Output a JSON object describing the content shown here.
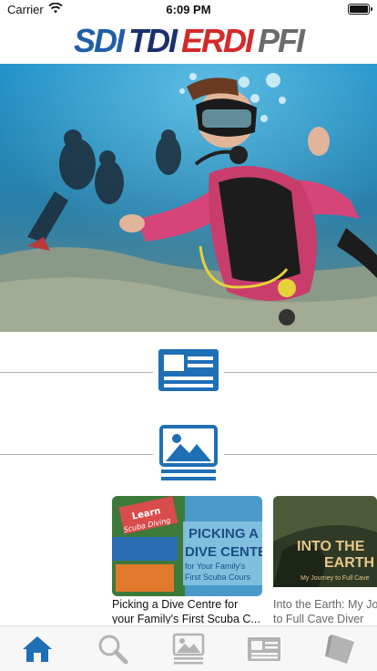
{
  "status_bar": {
    "carrier": "Carrier",
    "time": "6:09 PM",
    "battery_level": 1.0
  },
  "header": {
    "brands": [
      "SDI",
      "TDI",
      "ERDI",
      "PFI"
    ],
    "brand_colors": [
      "#1f5fa8",
      "#1c2f6e",
      "#d42a2a",
      "#6b6b6b"
    ]
  },
  "hero": {
    "icon": "scuba-divers-photo"
  },
  "sections": [
    {
      "icon": "news-card-icon"
    },
    {
      "icon": "gallery-icon"
    }
  ],
  "cards": [
    {
      "thumb_text": [
        "Learn",
        "Scuba Diving",
        "PICKING A",
        "DIVE CENTER",
        "for Your Family's",
        "First Scuba Cours"
      ],
      "title": "Picking a Dive Centre for your Family's First Scuba C..."
    },
    {
      "thumb_text": [
        "INTO THE",
        "EARTH",
        "My Journey to Full Cave"
      ],
      "title": "Into the Earth: My Journey to Full Cave Diver"
    }
  ],
  "card_titles": {
    "card1_line1": "Picking a Dive Centre for",
    "card1_line2": "your Family's First Scuba C...",
    "card2_line1": "Into the Earth: My Journ",
    "card2_line2": "to Full Cave Diver"
  },
  "tabs": [
    {
      "name": "home",
      "active": true
    },
    {
      "name": "search",
      "active": false
    },
    {
      "name": "gallery",
      "active": false
    },
    {
      "name": "news",
      "active": false
    },
    {
      "name": "book",
      "active": false
    }
  ],
  "colors": {
    "accent": "#1f6fb6",
    "inactive": "#b3b3b3"
  }
}
